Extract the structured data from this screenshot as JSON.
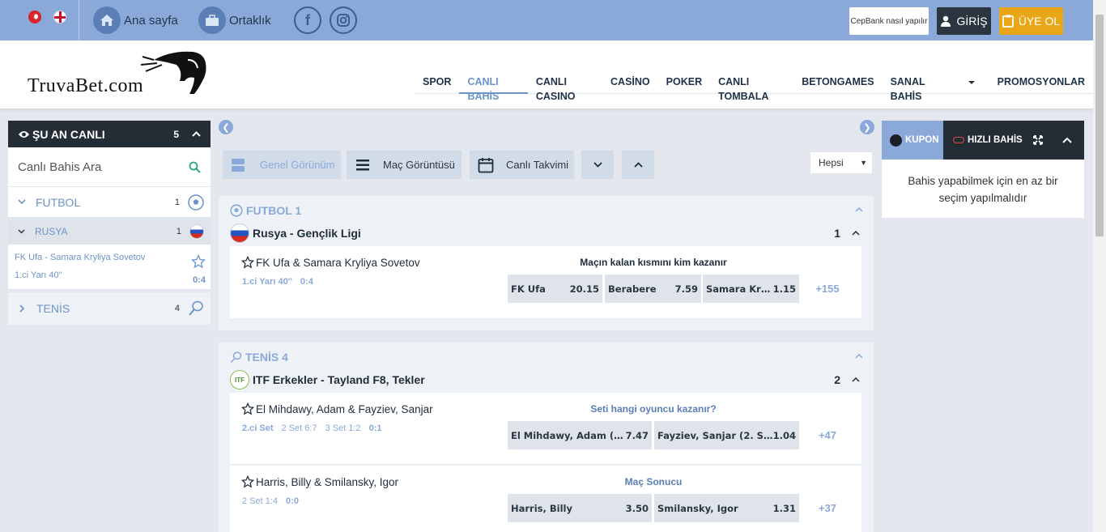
{
  "topbar": {
    "home_label": "Ana sayfa",
    "partner_label": "Ortaklık",
    "cepbank_label": "CepBank nasıl yapılır",
    "login_label": "GİRİŞ",
    "register_label": "ÜYE OL"
  },
  "logo_text": "TruvaBet.com",
  "nav": {
    "items": [
      "SPOR",
      "CANLI BAHİS",
      "CANLI CASINO",
      "CASİNO",
      "POKER",
      "CANLI TOMBALA",
      "BETONGAMES",
      "SANAL BAHİS",
      "PROMOSYONLAR"
    ],
    "active_index": 1
  },
  "sidebar": {
    "title": "ŞU AN CANLI",
    "count": "5",
    "search_placeholder": "Canlı Bahis Ara",
    "sports": [
      {
        "label": "FUTBOL",
        "count": "1"
      },
      {
        "label": "TENİS",
        "count": "4"
      }
    ],
    "country": {
      "label": "RUSYA",
      "count": "1"
    },
    "match": {
      "name": "FK Ufa - Samara Kryliya Sovetov",
      "time": "1.ci Yarı 40''",
      "score": "0:4"
    }
  },
  "view_buttons": {
    "general": "Genel Görünüm",
    "match_view": "Maç Görüntüsü",
    "calendar": "Canlı Takvimi",
    "filter": "Hepsi"
  },
  "sections": [
    {
      "title": "FUTBOL 1",
      "league": "Rusya - Gençlik Ligi",
      "league_count": "1",
      "matches": [
        {
          "name": "FK Ufa & Samara Kryliya Sovetov",
          "meta": [
            "1.ci Yarı 40''",
            "0:4"
          ],
          "market": "Maçın kalan kısmını kim kazanır",
          "odds": [
            {
              "label": "FK Ufa",
              "value": "20.15"
            },
            {
              "label": "Berabere",
              "value": "7.59"
            },
            {
              "label": "Samara Kryli...",
              "value": "1.15"
            }
          ],
          "more": "+155"
        }
      ]
    },
    {
      "title": "TENİS 4",
      "league": "ITF Erkekler - Tayland F8, Tekler",
      "league_count": "2",
      "matches": [
        {
          "name": "El Mihdawy, Adam & Fayziev, Sanjar",
          "meta": [
            "2.ci Set",
            "2 Set 6:7",
            "3 Set 1:2",
            "0:1"
          ],
          "market": "Seti hangi oyuncu kazanır?",
          "odds": [
            {
              "label": "El Mihdawy, Adam (2. S...",
              "value": "7.47"
            },
            {
              "label": "Fayziev, Sanjar (2. Set)",
              "value": "1.04"
            }
          ],
          "more": "+47"
        },
        {
          "name": "Harris, Billy & Smilansky, Igor",
          "meta": [
            "2 Set 1:4",
            "0:0"
          ],
          "market": "Maç Sonucu",
          "odds": [
            {
              "label": "Harris, Billy",
              "value": "3.50"
            },
            {
              "label": "Smilansky, Igor",
              "value": "1.31"
            }
          ],
          "more": "+37"
        }
      ]
    }
  ],
  "coupon": {
    "tab_coupon": "KUPON",
    "tab_quick": "HIZLI BAHİS",
    "message": "Bahis yapabilmek için en az bir seçim yapılmalıdır"
  },
  "colors": {
    "accent": "#8aa9d9",
    "dark": "#242d36",
    "register": "#e9a718"
  }
}
